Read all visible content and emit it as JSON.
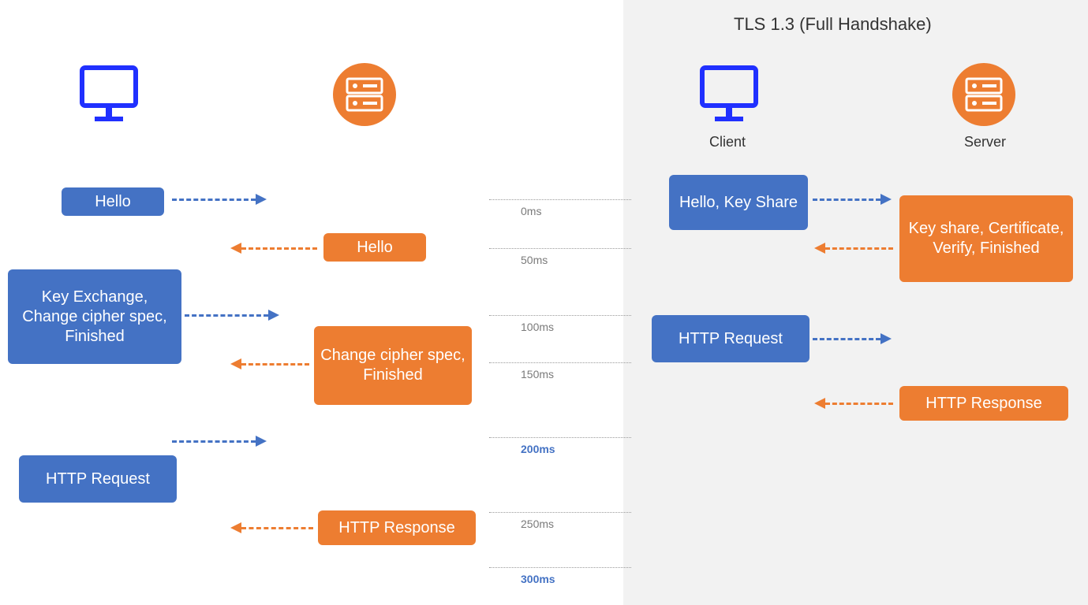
{
  "titles": {
    "right": "TLS 1.3 (Full Handshake)"
  },
  "labels": {
    "client": "Client",
    "server": "Server"
  },
  "left": {
    "m1": "Hello",
    "m2": "Hello",
    "m3": "Key Exchange, Change cipher spec, Finished",
    "m4": "Change cipher spec, Finished",
    "m5": "HTTP Request",
    "m6": "HTTP Response"
  },
  "right": {
    "m1": "Hello, Key Share",
    "m2": "Key share, Certificate, Verify, Finished",
    "m3": "HTTP Request",
    "m4": "HTTP Response"
  },
  "times": {
    "t0": "0ms",
    "t50": "50ms",
    "t100": "100ms",
    "t150": "150ms",
    "t200": "200ms",
    "t250": "250ms",
    "t300": "300ms"
  }
}
